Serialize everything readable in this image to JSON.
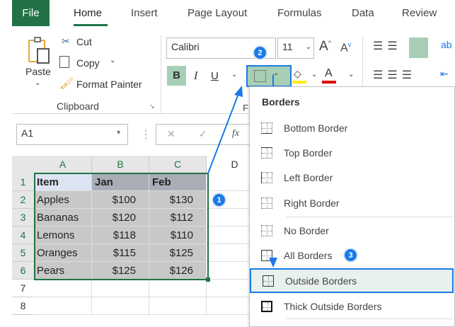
{
  "tabs": {
    "file": "File",
    "home": "Home",
    "insert": "Insert",
    "page_layout": "Page Layout",
    "formulas": "Formulas",
    "data": "Data",
    "review": "Review"
  },
  "clipboard": {
    "paste": "Paste",
    "cut": "Cut",
    "copy": "Copy",
    "format_painter": "Format Painter",
    "group_label": "Clipboard"
  },
  "font": {
    "name": "Calibri",
    "size": "11",
    "bold": "B",
    "italic": "I",
    "underline": "U",
    "font_color_letter": "A",
    "grow": "A",
    "shrink": "A",
    "group_label_partial": "F"
  },
  "formula_bar": {
    "name_box": "A1",
    "fx": "fx",
    "cancel": "✕",
    "enter": "✓"
  },
  "sheet": {
    "columns": [
      "A",
      "B",
      "C",
      "D"
    ],
    "rows": [
      "1",
      "2",
      "3",
      "4",
      "5",
      "6",
      "7",
      "8"
    ],
    "cells": [
      [
        "Item",
        "Jan",
        "Feb"
      ],
      [
        "Apples",
        "$100",
        "$130"
      ],
      [
        "Bananas",
        "$120",
        "$112"
      ],
      [
        "Lemons",
        "$118",
        "$110"
      ],
      [
        "Oranges",
        "$115",
        "$125"
      ],
      [
        "Pears",
        "$125",
        "$126"
      ]
    ]
  },
  "menu": {
    "title": "Borders",
    "items": [
      "Bottom Border",
      "Top Border",
      "Left Border",
      "Right Border",
      "No Border",
      "All Borders",
      "Outside Borders",
      "Thick Outside Borders"
    ],
    "selected": "Outside Borders"
  },
  "badges": [
    "1",
    "2",
    "3"
  ],
  "colors": {
    "excel_green": "#217346",
    "callout_blue": "#1a7ae8",
    "highlight_fill": "#e8f1ec",
    "fill_yellow": "#ffee00",
    "font_red": "#e00000"
  }
}
